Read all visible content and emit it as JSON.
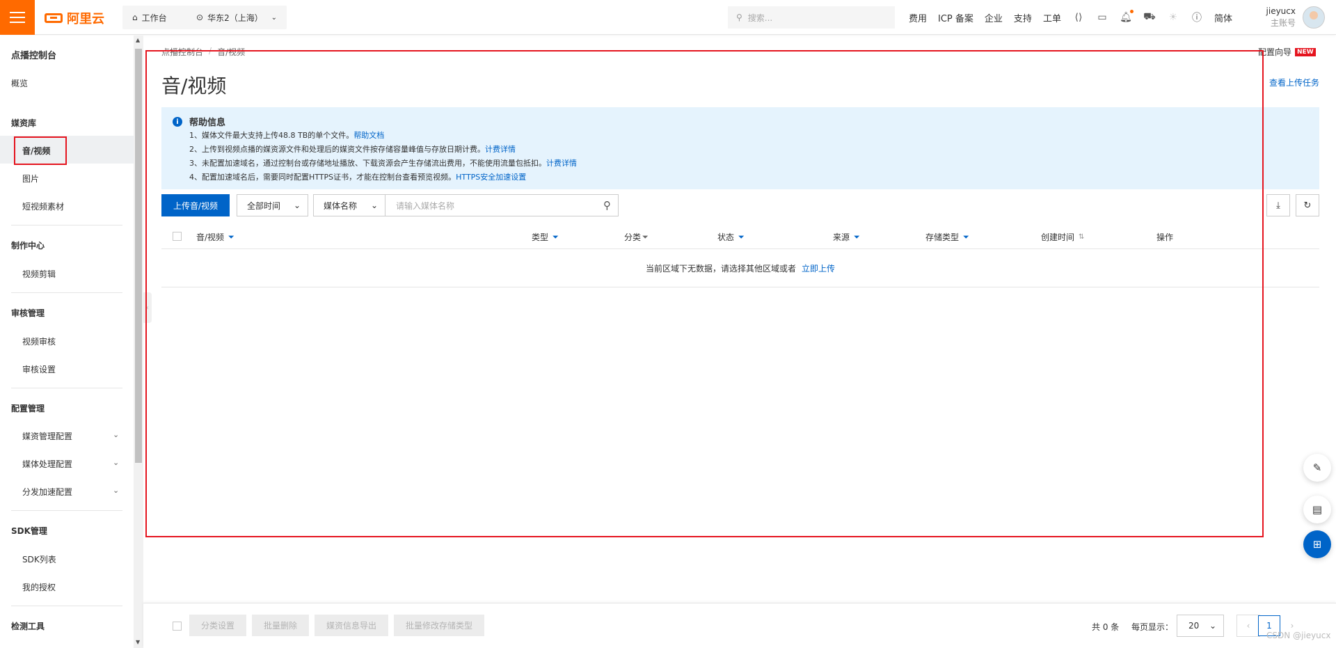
{
  "topbar": {
    "logo_text": "阿里云",
    "workbench": "工作台",
    "region": "华东2（上海）",
    "search_placeholder": "搜索...",
    "links": [
      "费用",
      "ICP 备案",
      "企业",
      "支持",
      "工单"
    ],
    "lang": "简体",
    "user_name": "jieyucx",
    "user_role": "主账号",
    "icons": [
      "code-icon",
      "terminal-icon",
      "bell-icon",
      "cart-icon",
      "bulb-icon",
      "help-icon"
    ]
  },
  "sidebar": {
    "title": "点播控制台",
    "overview": "概览",
    "sections": [
      {
        "title": "媒资库",
        "items": [
          "音/视频",
          "图片",
          "短视频素材"
        ]
      },
      {
        "title": "制作中心",
        "items": [
          "视频剪辑"
        ]
      },
      {
        "title": "审核管理",
        "items": [
          "视频审核",
          "审核设置"
        ]
      },
      {
        "title": "配置管理",
        "items": [
          "媒资管理配置",
          "媒体处理配置",
          "分发加速配置"
        ]
      },
      {
        "title": "SDK管理",
        "items": [
          "SDK列表",
          "我的授权"
        ]
      },
      {
        "title": "检测工具",
        "items": []
      }
    ]
  },
  "page": {
    "breadcrumb": [
      "点播控制台",
      "音/视频"
    ],
    "title": "音/视频",
    "config_guide": "配置向导",
    "new_badge": "NEW",
    "upload_tasks": "查看上传任务"
  },
  "help": {
    "title": "帮助信息",
    "lines": [
      {
        "text": "1、媒体文件最大支持上传48.8 TB的单个文件。",
        "link": "帮助文档"
      },
      {
        "text": "2、上传到视频点播的媒资源文件和处理后的媒资文件按存储容量峰值与存放日期计费。",
        "link": "计费详情"
      },
      {
        "text": "3、未配置加速域名，通过控制台或存储地址播放、下载资源会产生存储流出费用，不能使用流量包抵扣。",
        "link": "计费详情"
      },
      {
        "text": "4、配置加速域名后，需要同时配置HTTPS证书，才能在控制台查看预览视频。",
        "link": "HTTPS安全加速设置"
      }
    ]
  },
  "toolbar": {
    "upload_btn": "上传音/视频",
    "time_select": "全部时间",
    "field_select": "媒体名称",
    "search_placeholder": "请输入媒体名称"
  },
  "table": {
    "columns": [
      "音/视频",
      "类型",
      "分类",
      "状态",
      "来源",
      "存储类型",
      "创建时间",
      "操作"
    ],
    "empty_text": "当前区域下无数据，请选择其他区域或者",
    "empty_link": "立即上传"
  },
  "footer": {
    "buttons": [
      "分类设置",
      "批量删除",
      "媒资信息导出",
      "批量修改存储类型"
    ],
    "total": "共 0 条",
    "per_page_label": "每页显示：",
    "per_page_value": "20",
    "current_page": "1",
    "watermark": "CSDN @jieyucx"
  }
}
